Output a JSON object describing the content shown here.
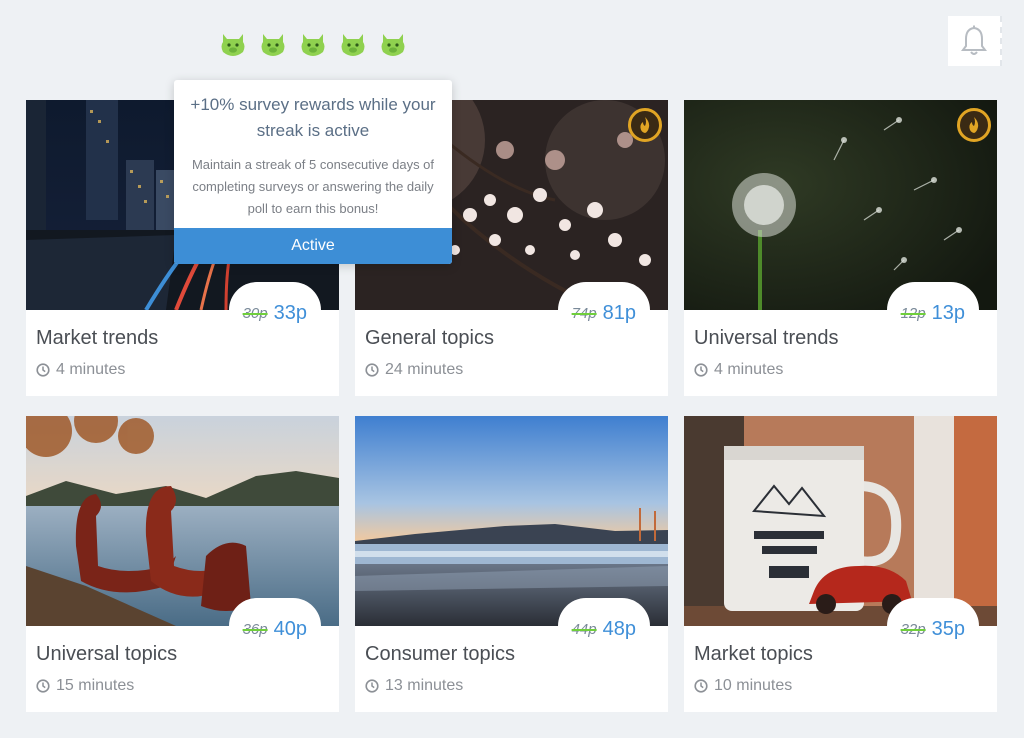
{
  "header": {
    "streak_icons": [
      "pig-icon",
      "pig-icon",
      "pig-icon",
      "pig-icon",
      "pig-icon"
    ],
    "notification_icon": "bell-icon"
  },
  "tooltip": {
    "title": "+10% survey rewards while your streak is active",
    "body": "Maintain a streak of 5 consecutive days of completing surveys or answering the daily poll to earn this bonus!",
    "button_label": "Active"
  },
  "colors": {
    "accent": "#3d8ed6",
    "price": "#3f8fd8",
    "strike": "#6fcf3b",
    "streak_green": "#8fd14f",
    "fire_badge": "#e1a524"
  },
  "surveys": [
    {
      "title": "Market trends",
      "duration": "4 minutes",
      "old_reward": "30p",
      "reward": "33p",
      "bonus_badge": false
    },
    {
      "title": "General topics",
      "duration": "24 minutes",
      "old_reward": "74p",
      "reward": "81p",
      "bonus_badge": true
    },
    {
      "title": "Universal trends",
      "duration": "4 minutes",
      "old_reward": "12p",
      "reward": "13p",
      "bonus_badge": true
    },
    {
      "title": "Universal topics",
      "duration": "15 minutes",
      "old_reward": "36p",
      "reward": "40p",
      "bonus_badge": false
    },
    {
      "title": "Consumer topics",
      "duration": "13 minutes",
      "old_reward": "44p",
      "reward": "48p",
      "bonus_badge": false
    },
    {
      "title": "Market topics",
      "duration": "10 minutes",
      "old_reward": "32p",
      "reward": "35p",
      "bonus_badge": false
    }
  ]
}
